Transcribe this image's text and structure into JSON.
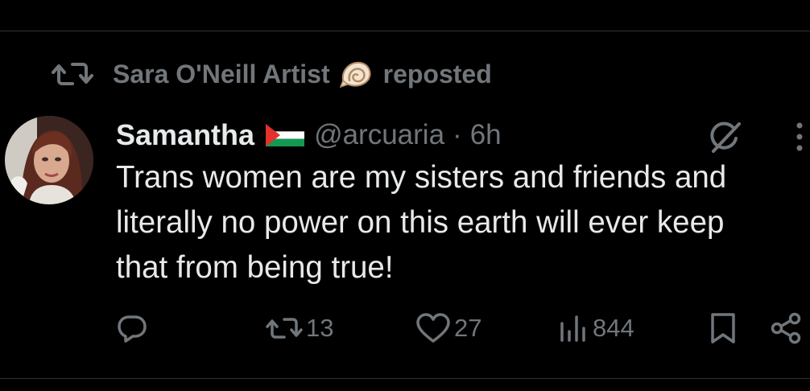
{
  "repost": {
    "icon": "repost-icon",
    "user": "Sara O'Neill Artist",
    "emoji": "shell-emoji",
    "suffix": "reposted"
  },
  "post": {
    "avatar": "avatar",
    "display_name": "Samantha",
    "flag": "palestine-flag-emoji",
    "handle": "@arcuaria",
    "separator": "·",
    "time": "6h",
    "text_lines": [
      "Trans women are my sisters and friends and",
      "literally no power on this earth will ever keep",
      "that from being true!"
    ]
  },
  "actions": {
    "reply_count": "",
    "repost_count": "13",
    "like_count": "27",
    "views_count": "844"
  },
  "colors": {
    "background": "#000000",
    "text_primary": "#e7e9ea",
    "text_secondary": "#71767b",
    "divider": "#2f3336"
  }
}
